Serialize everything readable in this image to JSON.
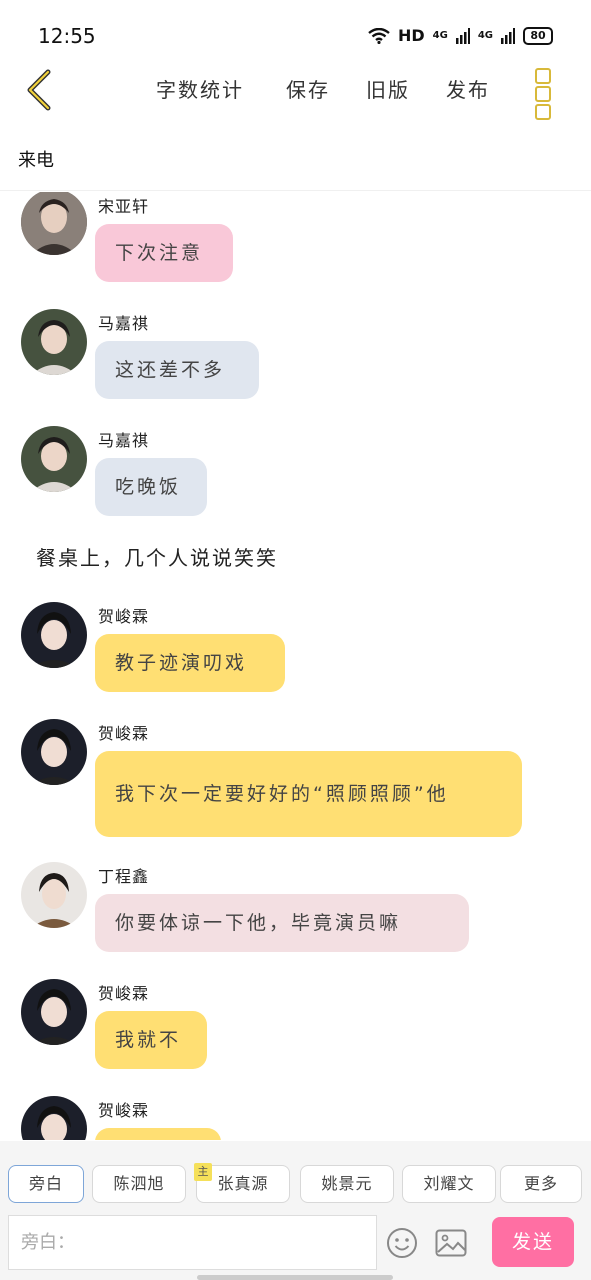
{
  "status": {
    "time": "12:55",
    "network": "HD",
    "signal1": "4G",
    "signal2": "4G",
    "battery": "80"
  },
  "toolbar": {
    "word_count_label": "字数统计",
    "save_label": "保存",
    "old_version_label": "旧版",
    "publish_label": "发布"
  },
  "page_title": "来电",
  "messages": [
    {
      "name": "宋亚轩",
      "text": "下次注意"
    },
    {
      "name": "马嘉祺",
      "text": "这还差不多"
    },
    {
      "name": "马嘉祺",
      "text": "吃晚饭"
    },
    {
      "narration": "餐桌上，几个人说说笑笑"
    },
    {
      "name": "贺峻霖",
      "text": "教子迹演叨戏"
    },
    {
      "name": "贺峻霖",
      "text": "我下次一定要好好的“照顾照顾”他"
    },
    {
      "name": "丁程鑫",
      "text": "你要体谅一下他，毕竟演员嘛"
    },
    {
      "name": "贺峻霖",
      "text": "我就不"
    },
    {
      "name": "贺峻霖",
      "text": ""
    }
  ],
  "roles": {
    "tabs": [
      "旁白",
      "陈泗旭",
      "张真源",
      "姚景元",
      "刘耀文",
      "更多"
    ],
    "main_badge": "主"
  },
  "input": {
    "placeholder": "旁白："
  },
  "send_label": "发送",
  "colors": {
    "pink_bubble": "#f9c8d8",
    "blue_bubble": "#e0e6ef",
    "yellow_bubble": "#ffdf73",
    "lightpink_bubble": "#f3dfe2",
    "send_button": "#ff6fa3",
    "accent_yellow": "#d8b93a"
  }
}
